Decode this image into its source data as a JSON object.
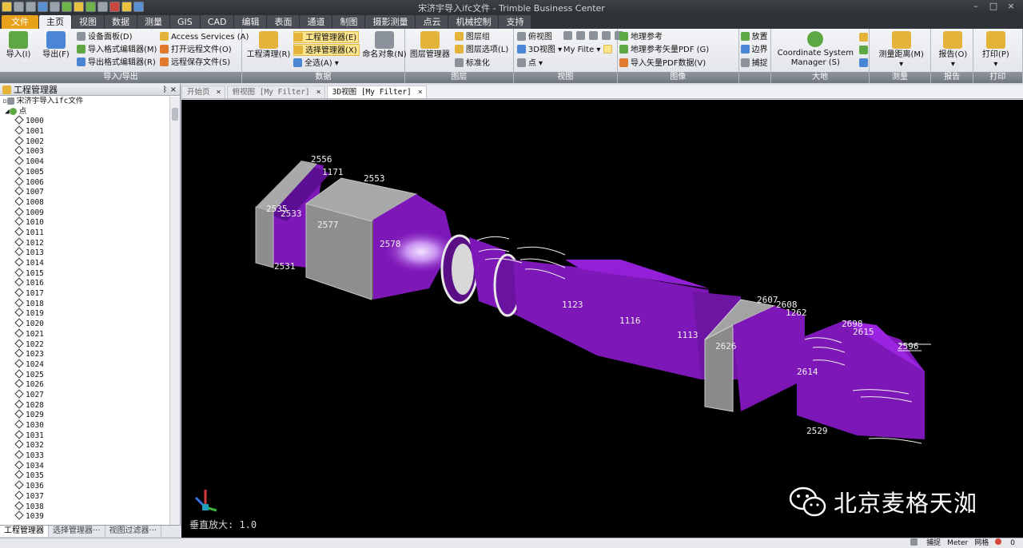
{
  "window": {
    "title": "宋济宇导入ifc文件 - Trimble Business Center",
    "controls": [
      "–",
      "□",
      "×"
    ]
  },
  "ribbon_tabs": [
    "文件",
    "主页",
    "视图",
    "数据",
    "测量",
    "GIS",
    "CAD",
    "编辑",
    "表面",
    "通道",
    "制图",
    "摄影测量",
    "点云",
    "机械控制",
    "支持"
  ],
  "ribbon": {
    "import_export": {
      "import": "导入(I)",
      "export": "导出(F)",
      "device_panel": "设备面板(D)",
      "import_format_editor": "导入格式编辑器(M)",
      "export_format_editor": "导出格式编辑器(R)",
      "access_services": "Access Services (A)",
      "open_remote": "打开远程文件(O)",
      "remote_save": "远程保存文件(S)",
      "caption": "导入/导出"
    },
    "data": {
      "project_cleanup": "工程清理(R)",
      "project_manager": "工程管理器(E)",
      "selection_manager": "选择管理器(X)",
      "select_all": "全选(A)",
      "name_objects": "命名对象(N)",
      "caption": "数据"
    },
    "layer": {
      "layer_manager": "图层管理器",
      "layer_group": "图层组",
      "layer_options": "图层选项(L)",
      "standardize": "标准化",
      "caption": "图层"
    },
    "view": {
      "plan_view": "俯视图",
      "view_3d": "3D视图",
      "filter": "My Filte",
      "point": "点",
      "caption": "视图"
    },
    "image": {
      "georef": "地理参考",
      "georef_pdf": "地理参考矢量PDF (G)",
      "import_pdf": "导入矢量PDF数据(V)",
      "place": "放置",
      "border": "边界",
      "capture": "捕捉",
      "caption": "图像"
    },
    "geodetic": {
      "cs_manager_1": "Coordinate System",
      "cs_manager_2": "Manager (S)",
      "caption": "大地"
    },
    "survey": {
      "measure_distance": "测量距离(M)",
      "caption": "测量"
    },
    "report": {
      "report": "报告(O)",
      "caption": "报告"
    },
    "print": {
      "print": "打印(P)",
      "caption": "打印"
    }
  },
  "project_explorer": {
    "title": "工程管理器",
    "pin": "ᛒ ×",
    "root": "宋济宇导入ifc文件",
    "points_node": "点",
    "points": [
      "1000",
      "1001",
      "1002",
      "1003",
      "1004",
      "1005",
      "1006",
      "1007",
      "1008",
      "1009",
      "1010",
      "1011",
      "1012",
      "1013",
      "1014",
      "1015",
      "1016",
      "1017",
      "1018",
      "1019",
      "1020",
      "1021",
      "1022",
      "1023",
      "1024",
      "1025",
      "1026",
      "1027",
      "1028",
      "1029",
      "1030",
      "1031",
      "1032",
      "1033",
      "1034",
      "1035",
      "1036",
      "1037",
      "1038",
      "1039"
    ],
    "bottom_tabs": [
      "工程管理器",
      "选择管理器···",
      "视图过滤器···"
    ]
  },
  "document_tabs": [
    {
      "label": "开始页",
      "close": "×"
    },
    {
      "label": "俯视图 [My Filter]",
      "close": "×"
    },
    {
      "label": "3D视图 [My Filter]",
      "close": "×"
    }
  ],
  "viewport": {
    "labels": [
      "2556",
      "1171",
      "2553",
      "2535",
      "2533",
      "2577",
      "2578",
      "1116",
      "1113",
      "2607",
      "2608",
      "1262",
      "2626",
      "2698",
      "2615",
      "2614",
      "2596",
      "1123",
      "2531",
      "2529"
    ],
    "vertical_exaggeration": "垂直放大: 1.0",
    "watermark": "北京麦格天洳"
  },
  "status_bar": {
    "snap": "捕捉",
    "unit": "Meter",
    "grid": "网格",
    "count": "0"
  },
  "colors": {
    "duct": "#7d17b8",
    "duct_dark": "#4e0c78",
    "box": "#8e8e8e",
    "background": "#000000",
    "accent_file": "#e8a21a"
  }
}
